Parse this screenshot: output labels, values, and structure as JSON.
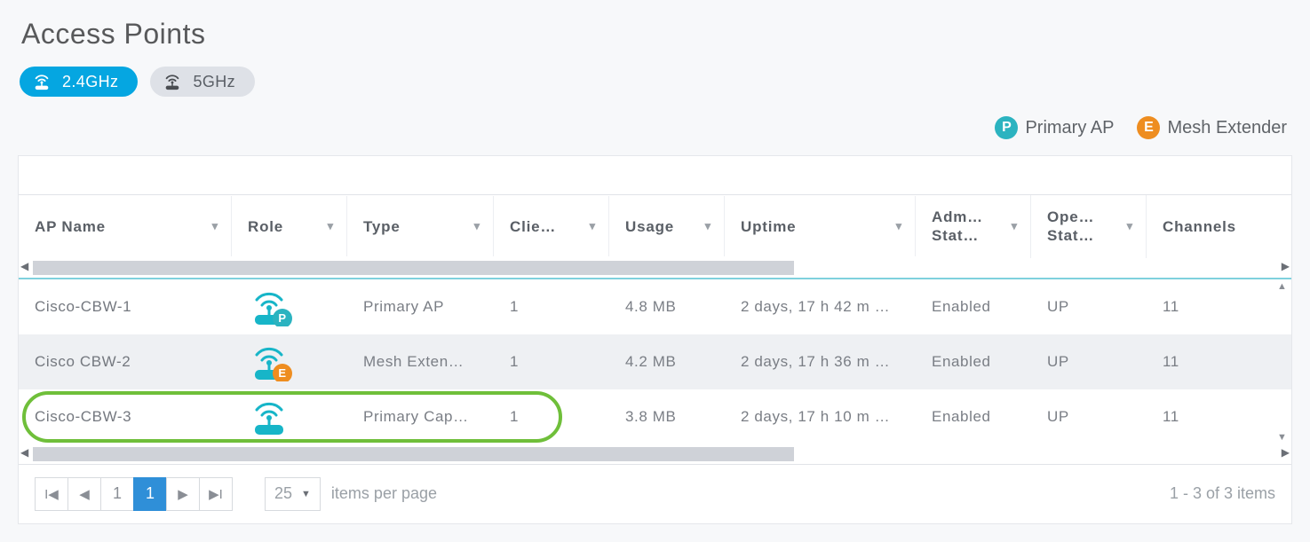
{
  "title": "Access Points",
  "tabs": {
    "ghz24": "2.4GHz",
    "ghz5": "5GHz",
    "active": "ghz24"
  },
  "legend": {
    "primary": {
      "letter": "P",
      "label": "Primary AP",
      "color": "#2bb3c0"
    },
    "extender": {
      "letter": "E",
      "label": "Mesh Extender",
      "color": "#ee8d20"
    }
  },
  "columns": {
    "ap_name": "AP Name",
    "role": "Role",
    "type": "Type",
    "clients": "Clie…",
    "usage": "Usage",
    "uptime": "Uptime",
    "admin": "Adm… Stat…",
    "oper": "Ope… Stat…",
    "channels": "Channels"
  },
  "rows": [
    {
      "ap_name": "Cisco-CBW-1",
      "role_badge": "P",
      "role_color": "#2bb3c0",
      "type": "Primary AP",
      "clients": "1",
      "usage": "4.8 MB",
      "uptime": "2 days, 17 h 42 m …",
      "admin": "Enabled",
      "oper": "UP",
      "channels": "11"
    },
    {
      "ap_name": "Cisco CBW-2",
      "role_badge": "E",
      "role_color": "#ee8d20",
      "type": "Mesh Exten…",
      "clients": "1",
      "usage": "4.2 MB",
      "uptime": "2 days, 17 h 36 m …",
      "admin": "Enabled",
      "oper": "UP",
      "channels": "11"
    },
    {
      "ap_name": "Cisco-CBW-3",
      "role_badge": "",
      "role_color": "",
      "type": "Primary Cap…",
      "clients": "1",
      "usage": "3.8 MB",
      "uptime": "2 days, 17 h 10 m …",
      "admin": "Enabled",
      "oper": "UP",
      "channels": "11"
    }
  ],
  "pager": {
    "page_input": "1",
    "current_page": "1",
    "per_page": "25",
    "per_page_label": "items per page",
    "summary": "1 - 3 of 3 items"
  },
  "icons": {
    "ap_color_active": "#ffffff",
    "ap_color_inactive": "#4a4d52",
    "role_icon_color": "#17b5c8"
  }
}
